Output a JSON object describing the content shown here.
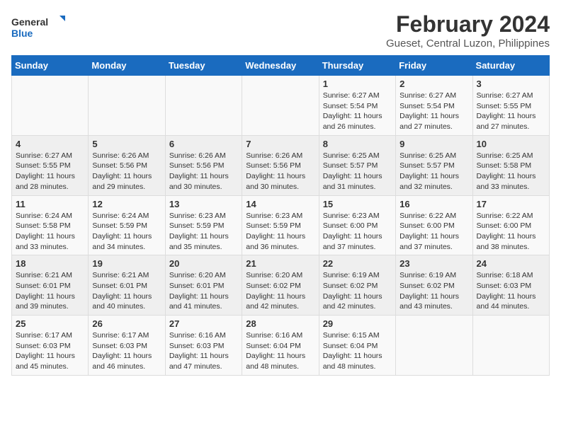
{
  "logo": {
    "line1": "General",
    "line2": "Blue"
  },
  "title": "February 2024",
  "subtitle": "Gueset, Central Luzon, Philippines",
  "days_of_week": [
    "Sunday",
    "Monday",
    "Tuesday",
    "Wednesday",
    "Thursday",
    "Friday",
    "Saturday"
  ],
  "weeks": [
    [
      {
        "day": "",
        "info": ""
      },
      {
        "day": "",
        "info": ""
      },
      {
        "day": "",
        "info": ""
      },
      {
        "day": "",
        "info": ""
      },
      {
        "day": "1",
        "info": "Sunrise: 6:27 AM\nSunset: 5:54 PM\nDaylight: 11 hours and 26 minutes."
      },
      {
        "day": "2",
        "info": "Sunrise: 6:27 AM\nSunset: 5:54 PM\nDaylight: 11 hours and 27 minutes."
      },
      {
        "day": "3",
        "info": "Sunrise: 6:27 AM\nSunset: 5:55 PM\nDaylight: 11 hours and 27 minutes."
      }
    ],
    [
      {
        "day": "4",
        "info": "Sunrise: 6:27 AM\nSunset: 5:55 PM\nDaylight: 11 hours and 28 minutes."
      },
      {
        "day": "5",
        "info": "Sunrise: 6:26 AM\nSunset: 5:56 PM\nDaylight: 11 hours and 29 minutes."
      },
      {
        "day": "6",
        "info": "Sunrise: 6:26 AM\nSunset: 5:56 PM\nDaylight: 11 hours and 30 minutes."
      },
      {
        "day": "7",
        "info": "Sunrise: 6:26 AM\nSunset: 5:56 PM\nDaylight: 11 hours and 30 minutes."
      },
      {
        "day": "8",
        "info": "Sunrise: 6:25 AM\nSunset: 5:57 PM\nDaylight: 11 hours and 31 minutes."
      },
      {
        "day": "9",
        "info": "Sunrise: 6:25 AM\nSunset: 5:57 PM\nDaylight: 11 hours and 32 minutes."
      },
      {
        "day": "10",
        "info": "Sunrise: 6:25 AM\nSunset: 5:58 PM\nDaylight: 11 hours and 33 minutes."
      }
    ],
    [
      {
        "day": "11",
        "info": "Sunrise: 6:24 AM\nSunset: 5:58 PM\nDaylight: 11 hours and 33 minutes."
      },
      {
        "day": "12",
        "info": "Sunrise: 6:24 AM\nSunset: 5:59 PM\nDaylight: 11 hours and 34 minutes."
      },
      {
        "day": "13",
        "info": "Sunrise: 6:23 AM\nSunset: 5:59 PM\nDaylight: 11 hours and 35 minutes."
      },
      {
        "day": "14",
        "info": "Sunrise: 6:23 AM\nSunset: 5:59 PM\nDaylight: 11 hours and 36 minutes."
      },
      {
        "day": "15",
        "info": "Sunrise: 6:23 AM\nSunset: 6:00 PM\nDaylight: 11 hours and 37 minutes."
      },
      {
        "day": "16",
        "info": "Sunrise: 6:22 AM\nSunset: 6:00 PM\nDaylight: 11 hours and 37 minutes."
      },
      {
        "day": "17",
        "info": "Sunrise: 6:22 AM\nSunset: 6:00 PM\nDaylight: 11 hours and 38 minutes."
      }
    ],
    [
      {
        "day": "18",
        "info": "Sunrise: 6:21 AM\nSunset: 6:01 PM\nDaylight: 11 hours and 39 minutes."
      },
      {
        "day": "19",
        "info": "Sunrise: 6:21 AM\nSunset: 6:01 PM\nDaylight: 11 hours and 40 minutes."
      },
      {
        "day": "20",
        "info": "Sunrise: 6:20 AM\nSunset: 6:01 PM\nDaylight: 11 hours and 41 minutes."
      },
      {
        "day": "21",
        "info": "Sunrise: 6:20 AM\nSunset: 6:02 PM\nDaylight: 11 hours and 42 minutes."
      },
      {
        "day": "22",
        "info": "Sunrise: 6:19 AM\nSunset: 6:02 PM\nDaylight: 11 hours and 42 minutes."
      },
      {
        "day": "23",
        "info": "Sunrise: 6:19 AM\nSunset: 6:02 PM\nDaylight: 11 hours and 43 minutes."
      },
      {
        "day": "24",
        "info": "Sunrise: 6:18 AM\nSunset: 6:03 PM\nDaylight: 11 hours and 44 minutes."
      }
    ],
    [
      {
        "day": "25",
        "info": "Sunrise: 6:17 AM\nSunset: 6:03 PM\nDaylight: 11 hours and 45 minutes."
      },
      {
        "day": "26",
        "info": "Sunrise: 6:17 AM\nSunset: 6:03 PM\nDaylight: 11 hours and 46 minutes."
      },
      {
        "day": "27",
        "info": "Sunrise: 6:16 AM\nSunset: 6:03 PM\nDaylight: 11 hours and 47 minutes."
      },
      {
        "day": "28",
        "info": "Sunrise: 6:16 AM\nSunset: 6:04 PM\nDaylight: 11 hours and 48 minutes."
      },
      {
        "day": "29",
        "info": "Sunrise: 6:15 AM\nSunset: 6:04 PM\nDaylight: 11 hours and 48 minutes."
      },
      {
        "day": "",
        "info": ""
      },
      {
        "day": "",
        "info": ""
      }
    ]
  ]
}
